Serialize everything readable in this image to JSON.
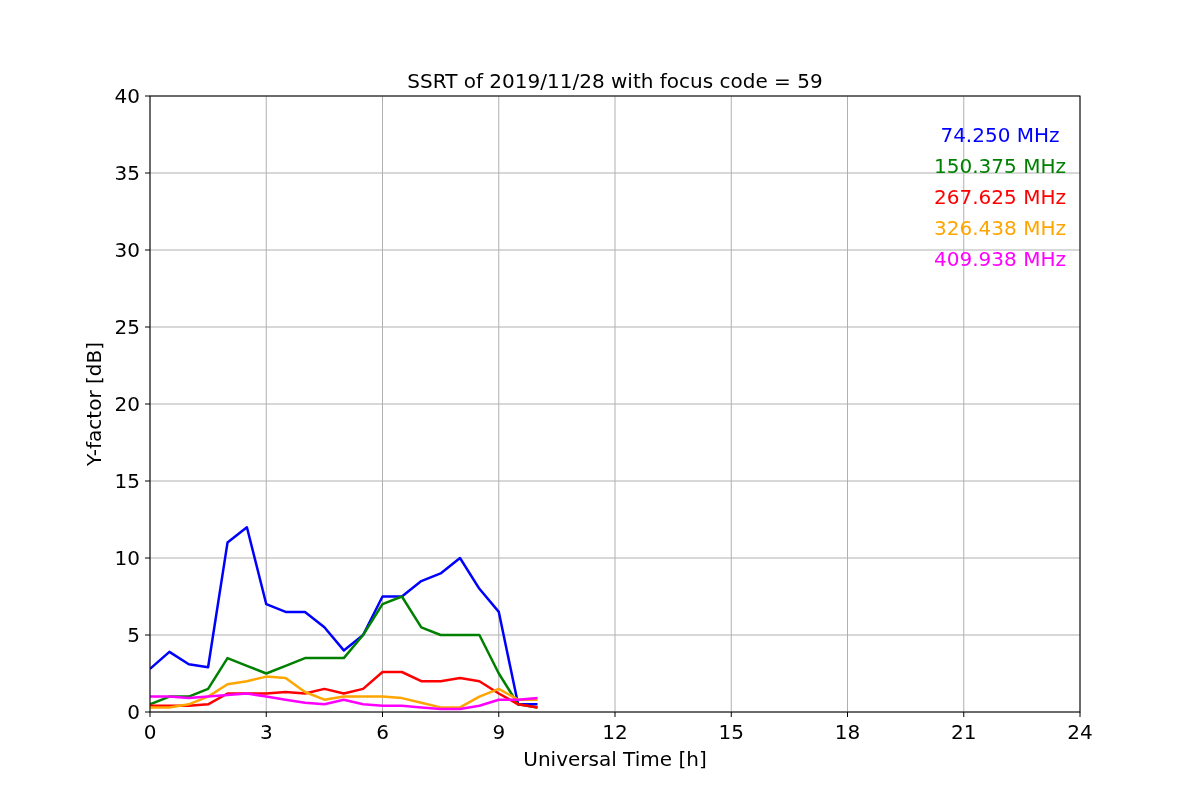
{
  "chart_data": {
    "type": "line",
    "title": "SSRT of 2019/11/28 with focus code = 59",
    "xlabel": "Universal Time [h]",
    "ylabel": "Y-factor [dB]",
    "x": [
      0,
      0.5,
      1,
      1.5,
      2,
      2.5,
      3,
      3.5,
      4,
      4.5,
      5,
      5.5,
      6,
      6.5,
      7,
      7.5,
      8,
      8.5,
      9,
      9.5,
      10
    ],
    "series": [
      {
        "name": "74.250 MHz",
        "color": "#0000ff",
        "values": [
          2.8,
          3.9,
          3.1,
          2.9,
          11,
          12,
          7,
          6.5,
          6.5,
          5.5,
          4,
          5,
          7.5,
          7.5,
          8.5,
          9,
          10,
          8,
          6.5,
          0.5,
          0.5
        ]
      },
      {
        "name": "150.375 MHz",
        "color": "#008000",
        "values": [
          0.5,
          1,
          1,
          1.5,
          3.5,
          3,
          2.5,
          3,
          3.5,
          3.5,
          3.5,
          5,
          7,
          7.5,
          5.5,
          5,
          5,
          5,
          2.5,
          0.5,
          0.3
        ]
      },
      {
        "name": "267.625 MHz",
        "color": "#ff0000",
        "values": [
          0.4,
          0.4,
          0.4,
          0.5,
          1.2,
          1.2,
          1.2,
          1.3,
          1.2,
          1.5,
          1.2,
          1.5,
          2.6,
          2.6,
          2,
          2,
          2.2,
          2,
          1.2,
          0.5,
          0.3
        ]
      },
      {
        "name": "326.438 MHz",
        "color": "#ffa500",
        "values": [
          0.3,
          0.3,
          0.5,
          1,
          1.8,
          2,
          2.3,
          2.2,
          1.3,
          0.8,
          1,
          1,
          1,
          0.9,
          0.6,
          0.3,
          0.3,
          1,
          1.5,
          0.8,
          0.8
        ]
      },
      {
        "name": "409.938 MHz",
        "color": "#ff00ff",
        "values": [
          1,
          1,
          0.9,
          1,
          1.1,
          1.2,
          1,
          0.8,
          0.6,
          0.5,
          0.8,
          0.5,
          0.4,
          0.4,
          0.3,
          0.2,
          0.2,
          0.4,
          0.8,
          0.8,
          0.9
        ]
      }
    ],
    "grid": true,
    "xlim": [
      0,
      24
    ],
    "ylim": [
      0,
      40
    ],
    "xticks": [
      0,
      3,
      6,
      9,
      12,
      15,
      18,
      21,
      24
    ],
    "yticks": [
      0,
      5,
      10,
      15,
      20,
      25,
      30,
      35,
      40
    ]
  }
}
